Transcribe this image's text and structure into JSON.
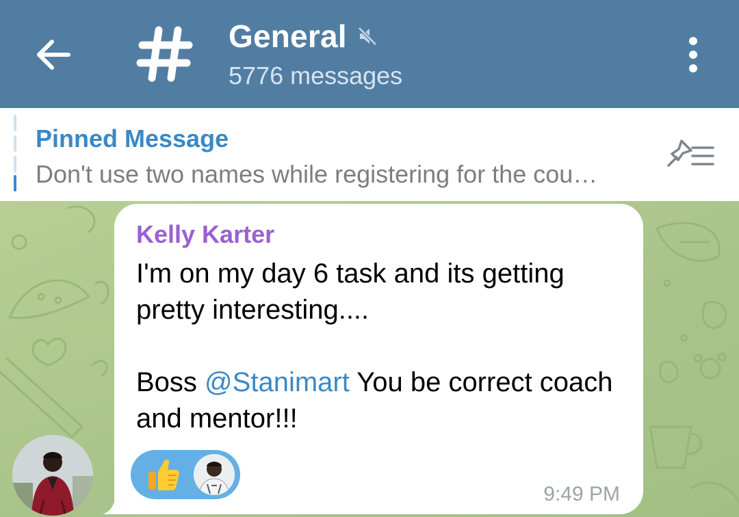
{
  "header": {
    "back_icon": "arrow-left-icon",
    "channel_icon": "hash-icon",
    "title": "General",
    "mute_icon": "muted-speaker-icon",
    "subtitle": "5776 messages",
    "menu_icon": "more-vertical-icon",
    "background": "#527da3"
  },
  "pinned": {
    "title": "Pinned Message",
    "text": "Don't use two names while registering for the cou…",
    "action_icon": "pin-list-icon"
  },
  "message": {
    "sender": "Kelly Karter",
    "sender_color": "#9a60d2",
    "text_line1": "I'm on my day 6 task and its getting pretty interesting....",
    "text_prefix": "Boss ",
    "mention": "@Stanimart",
    "text_suffix": " You be correct coach and mentor!!!",
    "reaction_emoji": "thumbs-up",
    "time": "9:49 PM"
  },
  "colors": {
    "accent": "#3a88c6",
    "chat_background": "#a9c48a",
    "reaction": "#64b0e4"
  }
}
